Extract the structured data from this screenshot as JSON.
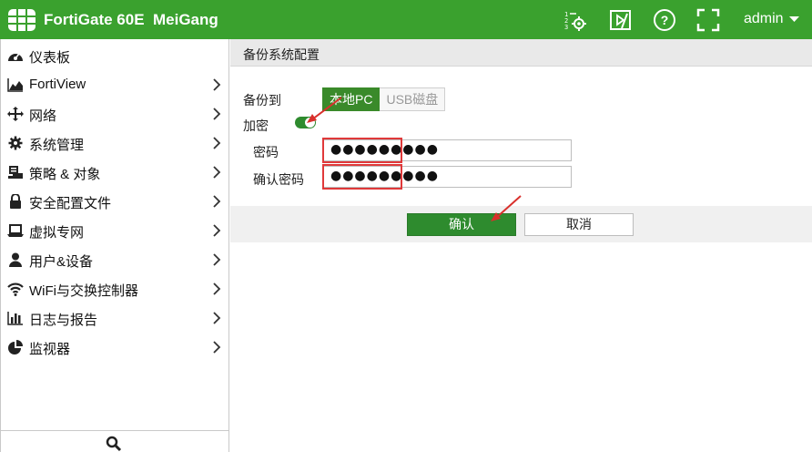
{
  "app": {
    "brand": "FortiGate 60E",
    "hostname": "MeiGang",
    "user_label": "admin",
    "accent_color": "#3aa12e"
  },
  "toolbar_icons": [
    "cli-console-icon",
    "fullscreen-video-icon",
    "help-icon",
    "expand-icon"
  ],
  "sidebar": {
    "items": [
      {
        "label": "仪表板",
        "icon": "dashboard-icon",
        "has_chevron": false
      },
      {
        "label": "FortiView",
        "icon": "area-chart-icon",
        "has_chevron": true
      },
      {
        "label": "网络",
        "icon": "network-arrows-icon",
        "has_chevron": true
      },
      {
        "label": "系统管理",
        "icon": "gear-icon",
        "has_chevron": true
      },
      {
        "label": "策略 & 对象",
        "icon": "policy-icon",
        "has_chevron": true
      },
      {
        "label": "安全配置文件",
        "icon": "lock-icon",
        "has_chevron": true
      },
      {
        "label": "虚拟专网",
        "icon": "laptop-icon",
        "has_chevron": true
      },
      {
        "label": "用户&设备",
        "icon": "user-icon",
        "has_chevron": true
      },
      {
        "label": "WiFi与交换控制器",
        "icon": "wifi-icon",
        "has_chevron": true
      },
      {
        "label": "日志与报告",
        "icon": "bar-chart-icon",
        "has_chevron": true
      },
      {
        "label": "监视器",
        "icon": "pie-chart-icon",
        "has_chevron": true
      }
    ]
  },
  "page": {
    "title": "备份系统配置",
    "backup_to_label": "备份到",
    "backup_options": {
      "selected": "本地PC",
      "other": "USB磁盘"
    },
    "encrypt_label": "加密",
    "encrypt_enabled": true,
    "password_label": "密码",
    "password_value": "●●●●●●●●●",
    "confirm_label": "确认密码",
    "confirm_value": "●●●●●●●●●",
    "ok_label": "确认",
    "cancel_label": "取消"
  }
}
